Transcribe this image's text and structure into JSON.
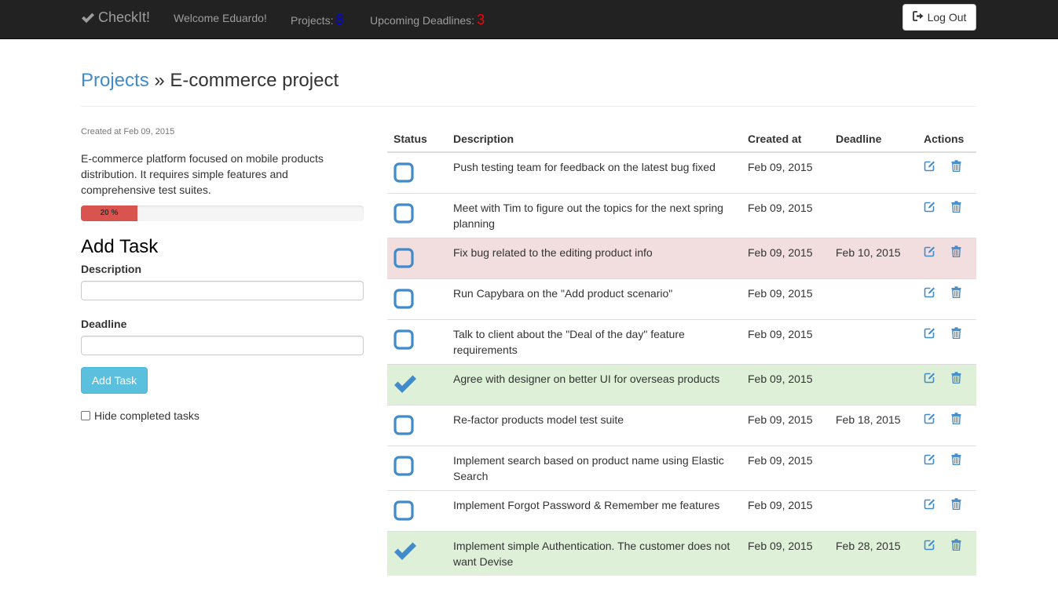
{
  "navbar": {
    "brand": "CheckIt!",
    "welcome": "Welcome Eduardo!",
    "projects_label": "Projects:",
    "projects_count": "8",
    "deadlines_label": "Upcoming Deadlines:",
    "deadlines_count": "3",
    "logout_label": "Log Out"
  },
  "breadcrumb": {
    "root": "Projects",
    "separator": "»",
    "current": "E-commerce project"
  },
  "project": {
    "created": "Created at Feb 09, 2015",
    "description": "E-commerce platform focused on mobile products distribution. It requires simple features and comprehensive test suites.",
    "progress_label": "20 %",
    "progress_value": 0.2
  },
  "form": {
    "title": "Add Task",
    "description_label": "Description",
    "description_value": "",
    "deadline_label": "Deadline",
    "deadline_value": "",
    "submit_label": "Add Task",
    "hide_completed_label": "Hide completed tasks"
  },
  "table": {
    "headers": {
      "status": "Status",
      "description": "Description",
      "created": "Created at",
      "deadline": "Deadline",
      "actions": "Actions"
    },
    "rows": [
      {
        "done": false,
        "highlight": "",
        "description": "Push testing team for feedback on the latest bug fixed",
        "created": "Feb 09, 2015",
        "deadline": ""
      },
      {
        "done": false,
        "highlight": "",
        "description": "Meet with Tim to figure out the topics for the next spring planning",
        "created": "Feb 09, 2015",
        "deadline": ""
      },
      {
        "done": false,
        "highlight": "danger",
        "description": "Fix bug related to the editing product info",
        "created": "Feb 09, 2015",
        "deadline": "Feb 10, 2015"
      },
      {
        "done": false,
        "highlight": "",
        "description": "Run Capybara on the \"Add product scenario\"",
        "created": "Feb 09, 2015",
        "deadline": ""
      },
      {
        "done": false,
        "highlight": "",
        "description": "Talk to client about the \"Deal of the day\" feature requirements",
        "created": "Feb 09, 2015",
        "deadline": ""
      },
      {
        "done": true,
        "highlight": "success",
        "description": "Agree with designer on better UI for overseas products",
        "created": "Feb 09, 2015",
        "deadline": ""
      },
      {
        "done": false,
        "highlight": "",
        "description": "Re-factor products model test suite",
        "created": "Feb 09, 2015",
        "deadline": "Feb 18, 2015"
      },
      {
        "done": false,
        "highlight": "",
        "description": "Implement search based on product name using Elastic Search",
        "created": "Feb 09, 2015",
        "deadline": ""
      },
      {
        "done": false,
        "highlight": "",
        "description": "Implement Forgot Password & Remember me features",
        "created": "Feb 09, 2015",
        "deadline": ""
      },
      {
        "done": true,
        "highlight": "success",
        "description": "Implement simple Authentication. The customer does not want Devise",
        "created": "Feb 09, 2015",
        "deadline": "Feb 28, 2015"
      }
    ]
  },
  "colors": {
    "link": "#428bca",
    "icon": "#428bca",
    "danger_row": "#f2dede",
    "success_row": "#dff0d8",
    "progress": "#d9534f",
    "projects_count": "#0000ff",
    "deadlines_count": "#ff0000"
  }
}
